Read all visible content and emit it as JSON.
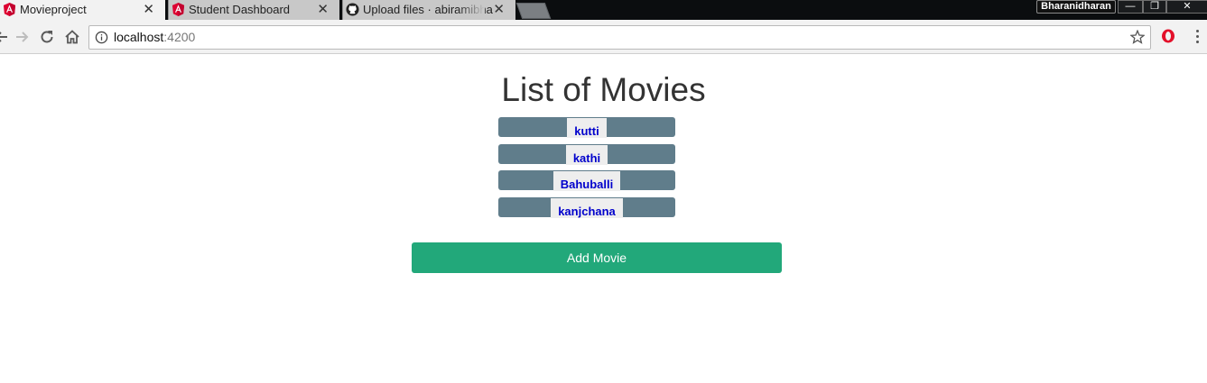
{
  "browser": {
    "tabs": [
      {
        "title": "Movieproject",
        "close": "✕"
      },
      {
        "title": "Student Dashboard",
        "close": "✕"
      },
      {
        "title": "Upload files · abiramibha",
        "close": "✕"
      }
    ],
    "profile_name": "Bharanidharan",
    "window_controls": {
      "minimize": "—",
      "maximize": "❐",
      "close": "✕"
    },
    "url_host": "localhost",
    "url_port": ":4200",
    "icons": {
      "back": "back-arrow-icon",
      "forward": "forward-arrow-icon",
      "reload": "reload-icon",
      "home": "home-icon",
      "info": "info-icon",
      "star": "star-icon",
      "opera": "opera-icon",
      "menu": "kebab-menu-icon"
    }
  },
  "page": {
    "title": "List of Movies",
    "movies": [
      "kutti",
      "kathi",
      "Bahuballi",
      "kanjchana"
    ],
    "add_button_label": "Add Movie",
    "colors": {
      "list_item_bg": "#607d8b",
      "movie_link": "#0000cc",
      "add_button_bg": "#22a87a"
    }
  }
}
